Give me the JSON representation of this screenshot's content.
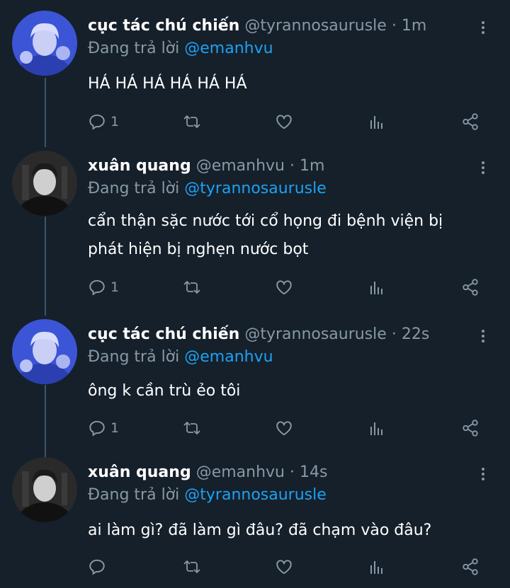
{
  "reply_prefix": "Đang trả lời",
  "tweets": [
    {
      "name": "cục tác chú chiến",
      "handle": "@tyrannosaurusle",
      "sep": " · ",
      "time": "1m",
      "reply_to": "@emanhvu",
      "text": "HÁ HÁ HÁ HÁ HÁ HÁ",
      "replies": "1",
      "avatar": "blue-avatar"
    },
    {
      "name": "xuân quang",
      "handle": "@emanhvu",
      "sep": " · ",
      "time": "1m",
      "reply_to": "@tyrannosaurusle",
      "text_lines": [
        "cẩn thận sặc nước tới cổ họng đi bệnh viện bị",
        "phát hiện bị nghẹn nước bọt"
      ],
      "replies": "1",
      "avatar": "bw-avatar"
    },
    {
      "name": "cục tác chú chiến",
      "handle": "@tyrannosaurusle",
      "sep": " · ",
      "time": "22s",
      "reply_to": "@emanhvu",
      "text": "ông k cần trù ẻo tôi",
      "replies": "1",
      "avatar": "blue-avatar"
    },
    {
      "name": "xuân quang",
      "handle": "@emanhvu",
      "sep": " · ",
      "time": "14s",
      "reply_to": "@tyrannosaurusle",
      "text": "ai làm gì? đã làm gì đâu? đã chạm vào đâu?",
      "replies": "",
      "avatar": "bw-avatar"
    }
  ],
  "colors": {
    "background": "#15202b",
    "secondary_text": "#8899a6",
    "link": "#1da1f2",
    "thread_line": "#3d5466"
  },
  "icons": [
    "reply-icon",
    "retweet-icon",
    "like-icon",
    "analytics-icon",
    "share-icon",
    "more-options-icon"
  ]
}
